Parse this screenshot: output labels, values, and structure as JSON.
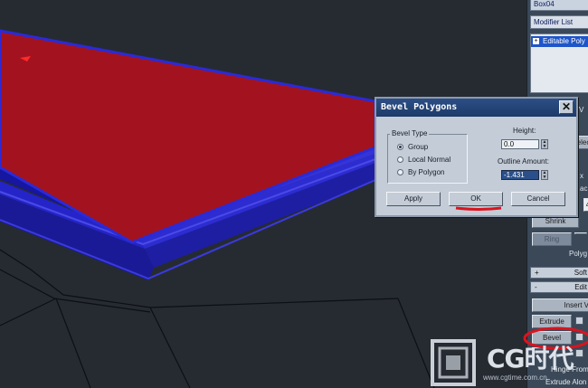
{
  "command_panel": {
    "object_name": "Box04",
    "modifier_list_label": "Modifier List",
    "stack_item": "Editable Poly",
    "stack_item_plus": "+",
    "shrink_label": "Shrink",
    "ring_label": "Ring",
    "polygon_label": "Polyg",
    "soft_selection_rollout": "Soft Se",
    "edit_polygons_rollout": "Edit Po",
    "rollout_plus": "+",
    "rollout_minus": "-",
    "insert_vertex_label": "Insert V",
    "extrude_label": "Extrude",
    "bevel_label": "Bevel",
    "hinge_label": "Hinge From",
    "extrude_along_label": "Extrude Alon",
    "partial_labels": [
      "elec",
      "x",
      "ack",
      "4",
      "V"
    ]
  },
  "dialog": {
    "title": "Bevel Polygons",
    "close_glyph": "✕",
    "bevel_type_label": "Bevel Type",
    "options": [
      {
        "label": "Group",
        "selected": true
      },
      {
        "label": "Local Normal",
        "selected": false
      },
      {
        "label": "By Polygon",
        "selected": false
      }
    ],
    "height_label": "Height:",
    "height_value": "0.0",
    "outline_label": "Outline Amount:",
    "outline_value": "-1.431",
    "apply_label": "Apply",
    "ok_label": "OK",
    "cancel_label": "Cancel"
  },
  "watermark": {
    "brand": "CG时代",
    "url": "www.cgtime.com.cn"
  },
  "colors": {
    "viewport_bg": "#262b32",
    "poly_top": "#a3131f",
    "poly_edge_blue": "#1f1fa8",
    "annotation_red": "#d9141e",
    "dialog_title": "#2c4f86"
  }
}
